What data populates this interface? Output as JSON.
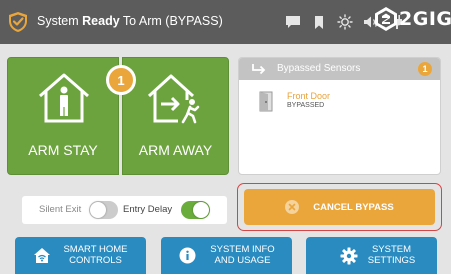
{
  "header": {
    "status_prefix": "System ",
    "status_bold": "Ready",
    "status_suffix": " To Arm (BYPASS)",
    "icons": [
      "shield-check-icon",
      "chat-bubble-icon",
      "bookmark-icon",
      "brightness-icon",
      "volume-icon",
      "plug-icon"
    ],
    "brand": "2GIG"
  },
  "arm": {
    "stay_label": "ARM STAY",
    "away_label": "ARM AWAY",
    "badge_count": "1"
  },
  "bypassed": {
    "title": "Bypassed Sensors",
    "count": "1",
    "items": [
      {
        "name": "Front Door",
        "state": "BYPASSED"
      }
    ]
  },
  "options": {
    "silent_exit_label": "Silent Exit",
    "silent_exit_on": false,
    "entry_delay_label": "Entry Delay",
    "entry_delay_on": true
  },
  "cancel_bypass": {
    "label": "CANCEL BYPASS"
  },
  "bottom_nav": {
    "smart_home": "SMART HOME\nCONTROLS",
    "system_info": "SYSTEM INFO\nAND USAGE",
    "system_settings": "SYSTEM\nSETTINGS"
  },
  "colors": {
    "arm_green": "#6da33f",
    "accent_orange": "#eba63b",
    "nav_blue": "#2a8bc0",
    "header_gray": "#5c5c5c",
    "alert_red": "#d64545"
  }
}
